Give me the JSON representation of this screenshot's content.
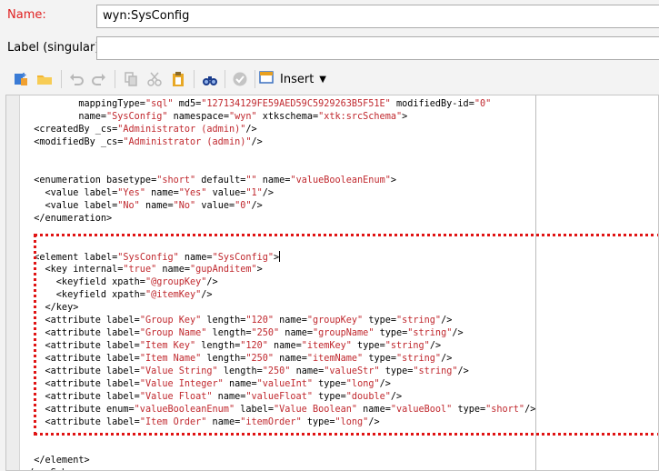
{
  "form": {
    "name_label": "Name:",
    "name_value": "wyn:SysConfig",
    "label_label": "Label (singular):",
    "label_value": ""
  },
  "toolbar": {
    "insert_label": "Insert",
    "icons": [
      "new-attribute-icon",
      "open-folder-icon",
      "undo-icon",
      "redo-icon",
      "copy-icon",
      "cut-icon",
      "paste-icon",
      "find-icon",
      "validate-icon",
      "insert-icon"
    ]
  },
  "colors": {
    "required_label": "#e02020",
    "value": "#c0282e",
    "highlight_border": "#e01414"
  },
  "code_lines": [
    [
      [
        "a",
        "          mappingType="
      ],
      [
        "v",
        "\"sql\""
      ],
      [
        "a",
        " md5="
      ],
      [
        "v",
        "\"127134129FE59AED59C5929263B5F51E\""
      ],
      [
        "a",
        " modifiedBy-id="
      ],
      [
        "v",
        "\"0\""
      ]
    ],
    [
      [
        "a",
        "          name="
      ],
      [
        "v",
        "\"SysConfig\""
      ],
      [
        "a",
        " namespace="
      ],
      [
        "v",
        "\"wyn\""
      ],
      [
        "a",
        " xtkschema="
      ],
      [
        "v",
        "\"xtk:srcSchema\""
      ],
      [
        "a",
        ">"
      ]
    ],
    [
      [
        "a",
        "  <createdBy _cs="
      ],
      [
        "v",
        "\"Administrator (admin)\""
      ],
      [
        "a",
        "/>"
      ]
    ],
    [
      [
        "a",
        "  <modifiedBy _cs="
      ],
      [
        "v",
        "\"Administrator (admin)\""
      ],
      [
        "a",
        "/>"
      ]
    ],
    [
      [
        "a",
        ""
      ]
    ],
    [
      [
        "a",
        ""
      ]
    ],
    [
      [
        "a",
        "  <enumeration basetype="
      ],
      [
        "v",
        "\"short\""
      ],
      [
        "a",
        " default="
      ],
      [
        "v",
        "\"\""
      ],
      [
        "a",
        " name="
      ],
      [
        "v",
        "\"valueBooleanEnum\""
      ],
      [
        "a",
        ">"
      ]
    ],
    [
      [
        "a",
        "    <value label="
      ],
      [
        "v",
        "\"Yes\""
      ],
      [
        "a",
        " name="
      ],
      [
        "v",
        "\"Yes\""
      ],
      [
        "a",
        " value="
      ],
      [
        "v",
        "\"1\""
      ],
      [
        "a",
        "/>"
      ]
    ],
    [
      [
        "a",
        "    <value label="
      ],
      [
        "v",
        "\"No\""
      ],
      [
        "a",
        " name="
      ],
      [
        "v",
        "\"No\""
      ],
      [
        "a",
        " value="
      ],
      [
        "v",
        "\"0\""
      ],
      [
        "a",
        "/>"
      ]
    ],
    [
      [
        "a",
        "  </enumeration>"
      ]
    ],
    [
      [
        "a",
        ""
      ]
    ],
    [
      [
        "a",
        ""
      ]
    ],
    [
      [
        "a",
        "  <element label="
      ],
      [
        "v",
        "\"SysConfig\""
      ],
      [
        "a",
        " name="
      ],
      [
        "v",
        "\"SysConfig\""
      ],
      [
        "a",
        ">"
      ]
    ],
    [
      [
        "a",
        "    <key internal="
      ],
      [
        "v",
        "\"true\""
      ],
      [
        "a",
        " name="
      ],
      [
        "v",
        "\"gupAnditem\""
      ],
      [
        "a",
        ">"
      ]
    ],
    [
      [
        "a",
        "      <keyfield xpath="
      ],
      [
        "v",
        "\"@groupKey\""
      ],
      [
        "a",
        "/>"
      ]
    ],
    [
      [
        "a",
        "      <keyfield xpath="
      ],
      [
        "v",
        "\"@itemKey\""
      ],
      [
        "a",
        "/>"
      ]
    ],
    [
      [
        "a",
        "    </key>"
      ]
    ],
    [
      [
        "a",
        "    <attribute label="
      ],
      [
        "v",
        "\"Group Key\""
      ],
      [
        "a",
        " length="
      ],
      [
        "v",
        "\"120\""
      ],
      [
        "a",
        " name="
      ],
      [
        "v",
        "\"groupKey\""
      ],
      [
        "a",
        " type="
      ],
      [
        "v",
        "\"string\""
      ],
      [
        "a",
        "/>"
      ]
    ],
    [
      [
        "a",
        "    <attribute label="
      ],
      [
        "v",
        "\"Group Name\""
      ],
      [
        "a",
        " length="
      ],
      [
        "v",
        "\"250\""
      ],
      [
        "a",
        " name="
      ],
      [
        "v",
        "\"groupName\""
      ],
      [
        "a",
        " type="
      ],
      [
        "v",
        "\"string\""
      ],
      [
        "a",
        "/>"
      ]
    ],
    [
      [
        "a",
        "    <attribute label="
      ],
      [
        "v",
        "\"Item Key\""
      ],
      [
        "a",
        " length="
      ],
      [
        "v",
        "\"120\""
      ],
      [
        "a",
        " name="
      ],
      [
        "v",
        "\"itemKey\""
      ],
      [
        "a",
        " type="
      ],
      [
        "v",
        "\"string\""
      ],
      [
        "a",
        "/>"
      ]
    ],
    [
      [
        "a",
        "    <attribute label="
      ],
      [
        "v",
        "\"Item Name\""
      ],
      [
        "a",
        " length="
      ],
      [
        "v",
        "\"250\""
      ],
      [
        "a",
        " name="
      ],
      [
        "v",
        "\"itemName\""
      ],
      [
        "a",
        " type="
      ],
      [
        "v",
        "\"string\""
      ],
      [
        "a",
        "/>"
      ]
    ],
    [
      [
        "a",
        "    <attribute label="
      ],
      [
        "v",
        "\"Value String\""
      ],
      [
        "a",
        " length="
      ],
      [
        "v",
        "\"250\""
      ],
      [
        "a",
        " name="
      ],
      [
        "v",
        "\"valueStr\""
      ],
      [
        "a",
        " type="
      ],
      [
        "v",
        "\"string\""
      ],
      [
        "a",
        "/>"
      ]
    ],
    [
      [
        "a",
        "    <attribute label="
      ],
      [
        "v",
        "\"Value Integer\""
      ],
      [
        "a",
        " name="
      ],
      [
        "v",
        "\"valueInt\""
      ],
      [
        "a",
        " type="
      ],
      [
        "v",
        "\"long\""
      ],
      [
        "a",
        "/>"
      ]
    ],
    [
      [
        "a",
        "    <attribute label="
      ],
      [
        "v",
        "\"Value Float\""
      ],
      [
        "a",
        " name="
      ],
      [
        "v",
        "\"valueFloat\""
      ],
      [
        "a",
        " type="
      ],
      [
        "v",
        "\"double\""
      ],
      [
        "a",
        "/>"
      ]
    ],
    [
      [
        "a",
        "    <attribute enum="
      ],
      [
        "v",
        "\"valueBooleanEnum\""
      ],
      [
        "a",
        " label="
      ],
      [
        "v",
        "\"Value Boolean\""
      ],
      [
        "a",
        " name="
      ],
      [
        "v",
        "\"valueBool\""
      ],
      [
        "a",
        " type="
      ],
      [
        "v",
        "\"short\""
      ],
      [
        "a",
        "/>"
      ]
    ],
    [
      [
        "a",
        "    <attribute label="
      ],
      [
        "v",
        "\"Item Order\""
      ],
      [
        "a",
        " name="
      ],
      [
        "v",
        "\"itemOrder\""
      ],
      [
        "a",
        " type="
      ],
      [
        "v",
        "\"long\""
      ],
      [
        "a",
        "/>"
      ]
    ],
    [
      [
        "a",
        ""
      ]
    ],
    [
      [
        "a",
        ""
      ]
    ],
    [
      [
        "a",
        "  </element>"
      ]
    ],
    [
      [
        "a",
        "</srcSchema>"
      ]
    ]
  ]
}
